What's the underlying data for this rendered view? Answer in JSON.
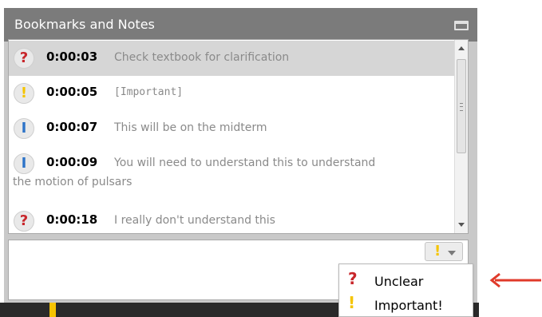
{
  "panel": {
    "title": "Bookmarks and Notes",
    "maximize_icon": "window-maximize-icon"
  },
  "bookmarks": [
    {
      "type": "unclear",
      "glyph": "?",
      "time": "0:00:03",
      "text": "Check textbook for clarification",
      "selected": true
    },
    {
      "type": "important",
      "glyph": "!",
      "time": "0:00:05",
      "text": "[Important]",
      "selected": false
    },
    {
      "type": "info",
      "glyph": "I",
      "time": "0:00:07",
      "text": "This will be on the midterm",
      "selected": false
    },
    {
      "type": "info",
      "glyph": "I",
      "time": "0:00:09",
      "text": "You will need to understand this to understand",
      "text_line2": "the motion of pulsars",
      "selected": false
    },
    {
      "type": "unclear",
      "glyph": "?",
      "time": "0:00:18",
      "text": "I really don't understand this",
      "selected": false
    }
  ],
  "note_input": {
    "value": "",
    "placeholder": ""
  },
  "type_button": {
    "glyph": "!",
    "icon": "important-icon",
    "chevron": "chevron-down-icon"
  },
  "dropdown": {
    "options": [
      {
        "glyph": "?",
        "label": "Unclear",
        "icon": "question-mark-icon"
      },
      {
        "glyph": "!",
        "label": "Important!",
        "icon": "exclamation-icon"
      }
    ]
  },
  "colors": {
    "title_bar": "#7b7b7b",
    "selected_row": "#d6d6d6",
    "unclear_red": "#c8262b",
    "important_yellow": "#f5c400",
    "info_blue": "#2c73c8",
    "annotation_arrow": "#e03a2a"
  }
}
